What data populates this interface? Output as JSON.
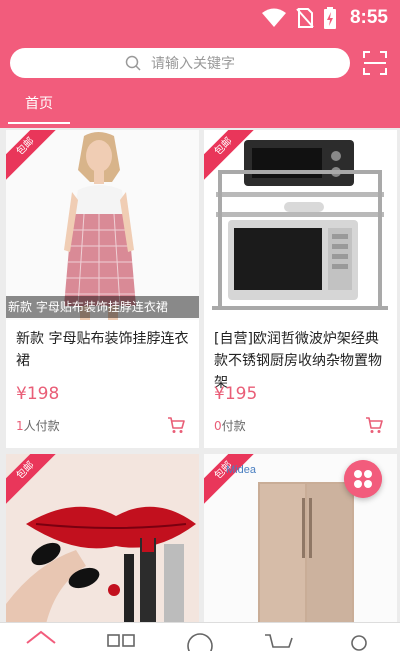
{
  "status": {
    "time": "8:55"
  },
  "search": {
    "placeholder": "请输入关键字"
  },
  "tabs": [
    {
      "label": "首页"
    }
  ],
  "ribbon_text": "包邮",
  "products": [
    {
      "image_caption": "新款 字母贴布装饰挂脖连衣裙",
      "title": "新款 字母贴布装饰挂脖连衣裙",
      "price": "¥198",
      "buyers_count": "1",
      "buyers_suffix": "人付款"
    },
    {
      "title": "[自营]欧润哲微波炉架经典款不锈钢厨房收纳杂物置物架",
      "price": "¥195",
      "buyers_count": "0",
      "buyers_suffix": "付款"
    },
    {
      "brand_text": "Midea"
    }
  ],
  "colors": {
    "brand": "#f25c7c",
    "price": "#e95e77",
    "ribbon": "#e9365a"
  },
  "icons": {
    "search": "search-icon",
    "scan": "scan-icon",
    "cart": "cart-icon",
    "menu": "grid-menu-icon"
  }
}
